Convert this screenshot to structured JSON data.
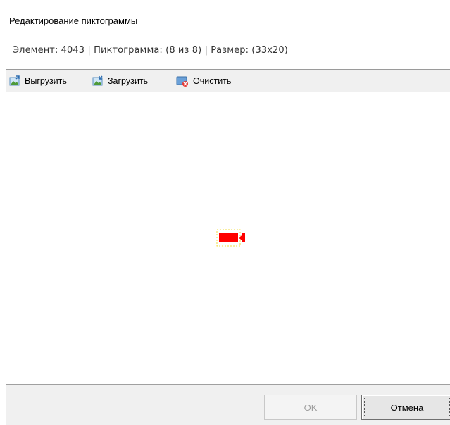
{
  "window": {
    "title": "Редактирование пиктограммы",
    "info": "Элемент: 4043 | Пиктограмма: (8 из 8) | Размер: (33x20)"
  },
  "toolbar": {
    "export_label": "Выгрузить",
    "import_label": "Загрузить",
    "clear_label": "Очистить"
  },
  "preview": {
    "icon": "video-camera-icon",
    "fill_color": "#ff0000",
    "selection_color": "#f5e34a"
  },
  "footer": {
    "ok_label": "OK",
    "cancel_label": "Отмена"
  }
}
